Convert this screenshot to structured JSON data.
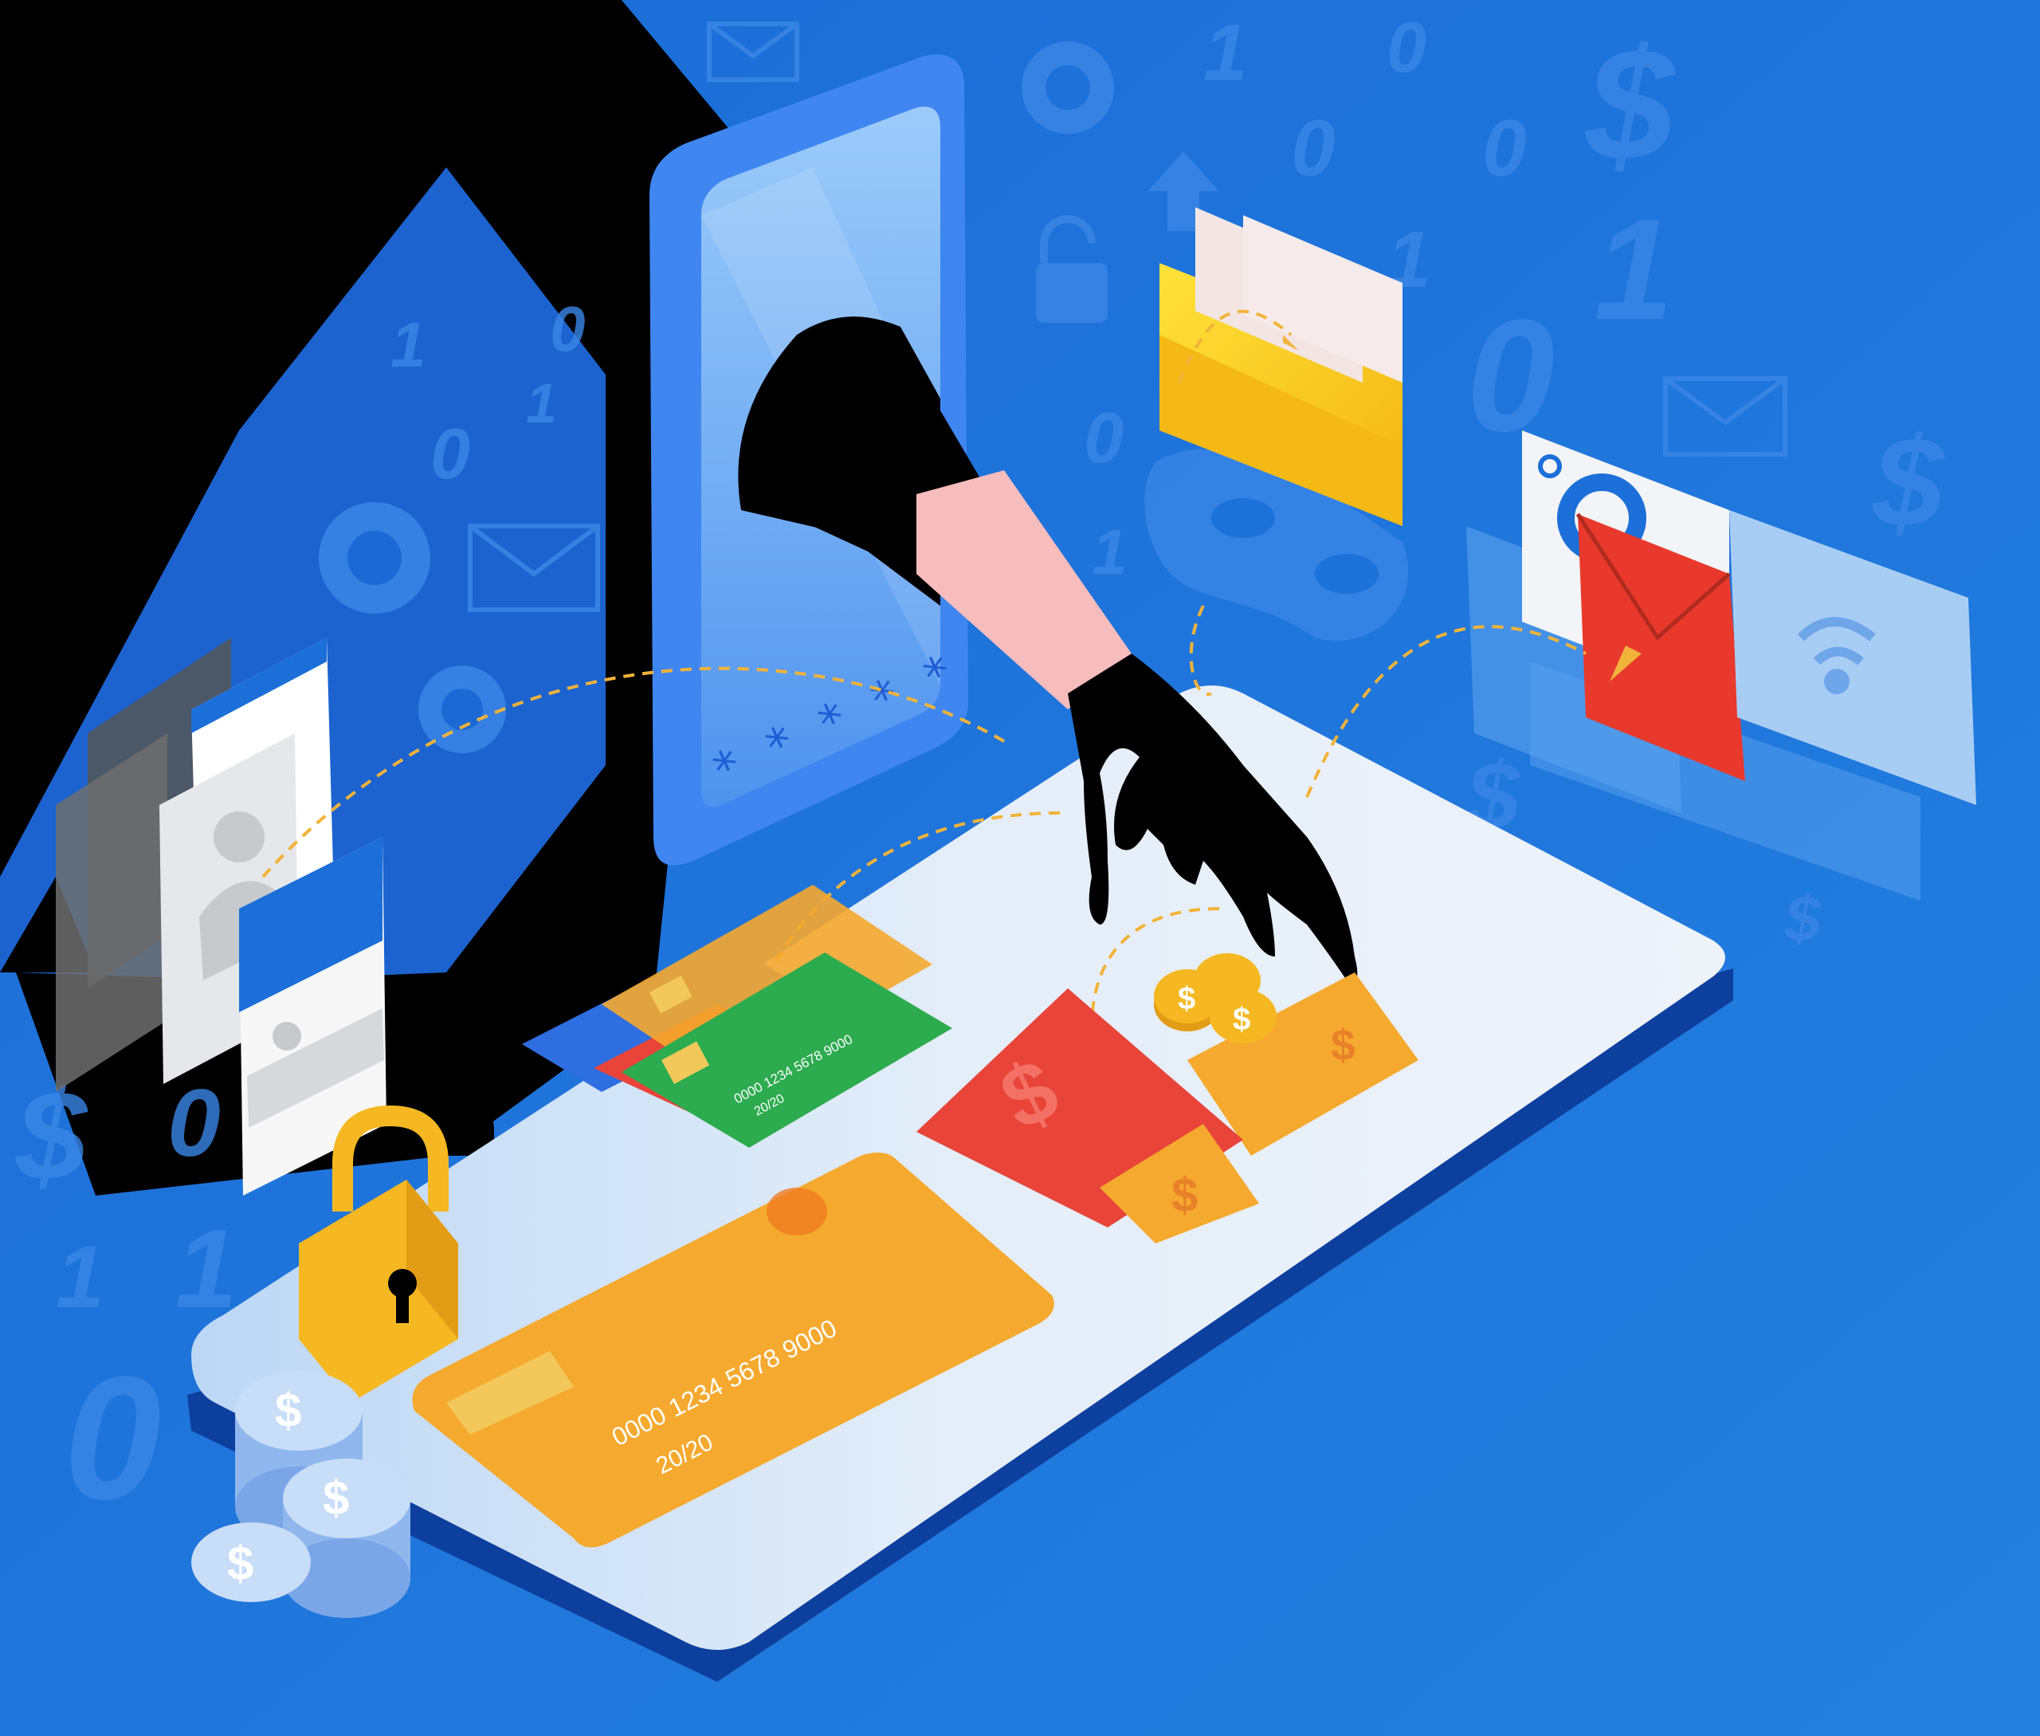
{
  "palette": {
    "background": "#1c6fd8",
    "background_deep": "#0f58c4",
    "shadow_silhouette": "#000000",
    "platform_top": "#dfeaf7",
    "platform_edge": "#0d3f9e",
    "phone_body": "#3f86f0",
    "phone_screen": "#8dc0f7",
    "glove": "#000000",
    "skin": "#f7bcbc",
    "card_orange": "#f5a92e",
    "card_green": "#2dab4f",
    "card_red": "#e8443a",
    "folder_yellow": "#f7c21f",
    "coin_gold": "#f5b822",
    "coin_blue": "#a9c9f5",
    "dashed_arrow": "#f2b33a"
  },
  "phone": {
    "password_mask": "* * * * *"
  },
  "cards": {
    "large": {
      "number": "0000  1234  5678  9000",
      "expiry": "20/20"
    },
    "green": {
      "number": "0000  1234  5678  9000",
      "expiry": "20/20"
    }
  },
  "icons": {
    "padlock": "padlock-icon",
    "envelope": "envelope-icon",
    "wifi": "wifi-icon",
    "dollar": "dollar-icon",
    "location": "location-pin-icon",
    "folder": "folder-icon",
    "user": "user-profile-icon",
    "eye_mask": "eye-mask-icon",
    "unlocked": "unlocked-padlock-icon",
    "arrow_up": "arrow-up-icon"
  },
  "background_glyphs": {
    "one": "1",
    "zero": "0",
    "dollar": "$"
  },
  "coin_symbol": "$"
}
